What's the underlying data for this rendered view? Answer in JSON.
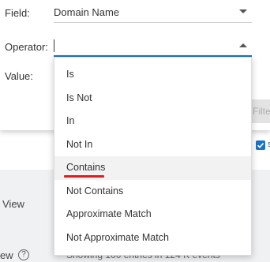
{
  "dialog": {
    "field_label": "Field:",
    "field_value": "Domain Name",
    "operator_label": "Operator:",
    "operator_value": "",
    "value_label": "Value:",
    "filter_button": "Filter"
  },
  "operator_options": [
    "Is",
    "Is Not",
    "In",
    "Not In",
    "Contains",
    "Not Contains",
    "Approximate Match",
    "Not Approximate Match"
  ],
  "hovered_option": "Contains",
  "background": {
    "view_label": "View",
    "view_label2": "ew",
    "help_icon": "?",
    "showing_text": "Showing 100 entries in 124 K events",
    "checkbox_suffix": "s"
  },
  "colors": {
    "accent": "#1a73c8",
    "annotation_underline": "#d91f1f",
    "hover_bg": "#f2f2f2"
  }
}
